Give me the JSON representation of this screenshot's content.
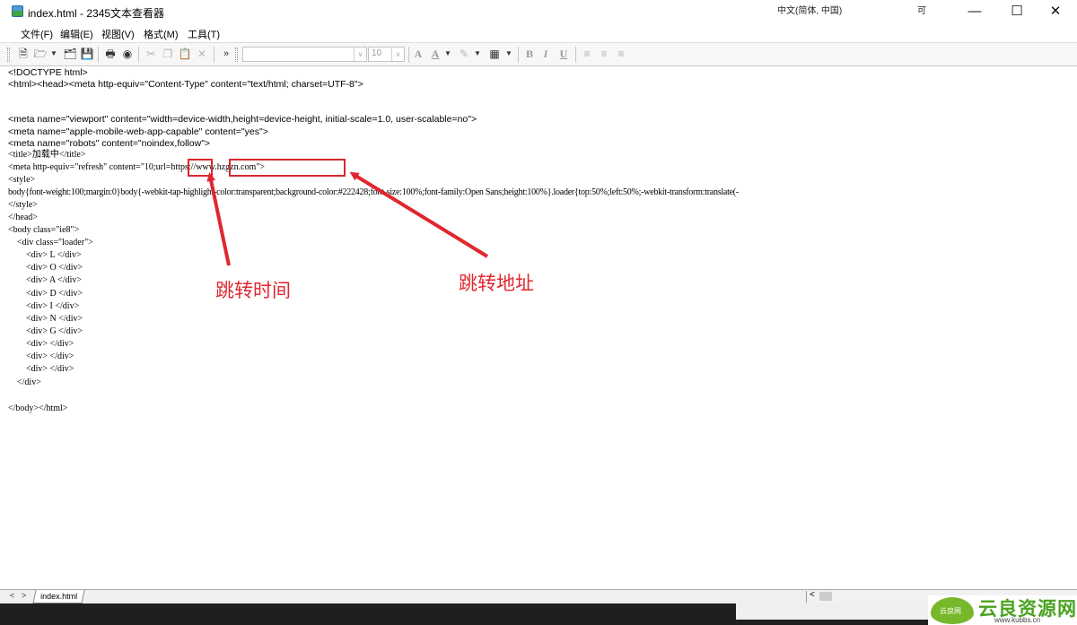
{
  "window": {
    "title": "index.html - 2345文本查看器"
  },
  "menu": [
    "文件(F)",
    "编辑(E)",
    "视图(V)",
    "格式(M)",
    "工具(T)"
  ],
  "toolbar": {
    "more": "»",
    "font_size": "10"
  },
  "editor": {
    "lines": [
      "<!DOCTYPE html>",
      "<html><head><meta http-equiv=\"Content-Type\" content=\"text/html; charset=UTF-8\">",
      "",
      "",
      "<meta name=\"viewport\" content=\"width=device-width,height=device-height, initial-scale=1.0, user-scalable=no\">",
      "<meta name=\"apple-mobile-web-app-capable\" content=\"yes\">",
      "<meta name=\"robots\" content=\"noindex,follow\">",
      "<title>加载中</title>",
      "<meta http-equiv=\"refresh\" content=\"10;url=https://www.hzgzn.com\">",
      "<style>",
      "body{font-weight:100;margin:0}body{-webkit-tap-highlight-color:transparent;background-color:#222428;font-size:100%;font-family:Open Sans;height:100%}.loader{top:50%;left:50%;-webkit-transform:translate(-",
      "</style>",
      "</head>",
      "<body class=\"ie8\">",
      "    <div class=\"loader\">",
      "        <div> L </div>",
      "        <div> O </div>",
      "        <div> A </div>",
      "        <div> D </div>",
      "        <div> I </div>",
      "        <div> N </div>",
      "        <div> G </div>",
      "        <div> </div>",
      "        <div> </div>",
      "        <div> </div>",
      "    </div>",
      "",
      "</body></html>"
    ]
  },
  "annotations": {
    "time_label": "跳转时间",
    "url_label": "跳转地址"
  },
  "tabs": {
    "active": "index.html"
  },
  "status": {
    "ime": "中文(简体, 中国)",
    "partial": "可"
  },
  "watermark": {
    "brand": "云良资源网",
    "leaf": "云良网",
    "url": "www.kubbs.cn"
  },
  "colors": {
    "annotation_red": "#d7282f",
    "watermark_green": "#4ba321"
  }
}
